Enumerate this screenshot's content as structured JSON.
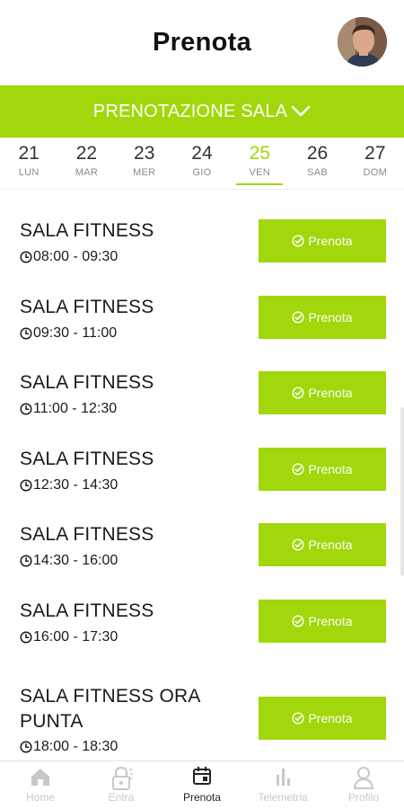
{
  "header": {
    "title": "Prenota"
  },
  "category": {
    "label": "PRENOTAZIONE SALA"
  },
  "days": [
    {
      "num": "21",
      "name": "LUN",
      "active": false
    },
    {
      "num": "22",
      "name": "MAR",
      "active": false
    },
    {
      "num": "23",
      "name": "MER",
      "active": false
    },
    {
      "num": "24",
      "name": "GIO",
      "active": false
    },
    {
      "num": "25",
      "name": "VEN",
      "active": true
    },
    {
      "num": "26",
      "name": "SAB",
      "active": false
    },
    {
      "num": "27",
      "name": "DOM",
      "active": false
    }
  ],
  "slots": [
    {
      "name": "SALA FITNESS",
      "time": "08:00 - 09:30",
      "button": "Prenota"
    },
    {
      "name": "SALA FITNESS",
      "time": "09:30 - 11:00",
      "button": "Prenota"
    },
    {
      "name": "SALA FITNESS",
      "time": "11:00 - 12:30",
      "button": "Prenota"
    },
    {
      "name": "SALA FITNESS",
      "time": "12:30 - 14:30",
      "button": "Prenota"
    },
    {
      "name": "SALA FITNESS",
      "time": "14:30 - 16:00",
      "button": "Prenota"
    },
    {
      "name": "SALA FITNESS",
      "time": "16:00 - 17:30",
      "button": "Prenota"
    },
    {
      "name": "SALA FITNESS ORA PUNTA",
      "time": "18:00 - 18:30",
      "button": "Prenota"
    }
  ],
  "tabs": [
    {
      "label": "Home",
      "icon": "home-icon",
      "active": false
    },
    {
      "label": "Entra",
      "icon": "lock-icon",
      "active": false
    },
    {
      "label": "Prenota",
      "icon": "calendar-icon",
      "active": true
    },
    {
      "label": "Telemetria",
      "icon": "bar-chart-icon",
      "active": false
    },
    {
      "label": "Profilo",
      "icon": "user-icon",
      "active": false
    }
  ],
  "colors": {
    "accent": "#a1d70b",
    "inactive_tab": "#c8c8c8"
  }
}
